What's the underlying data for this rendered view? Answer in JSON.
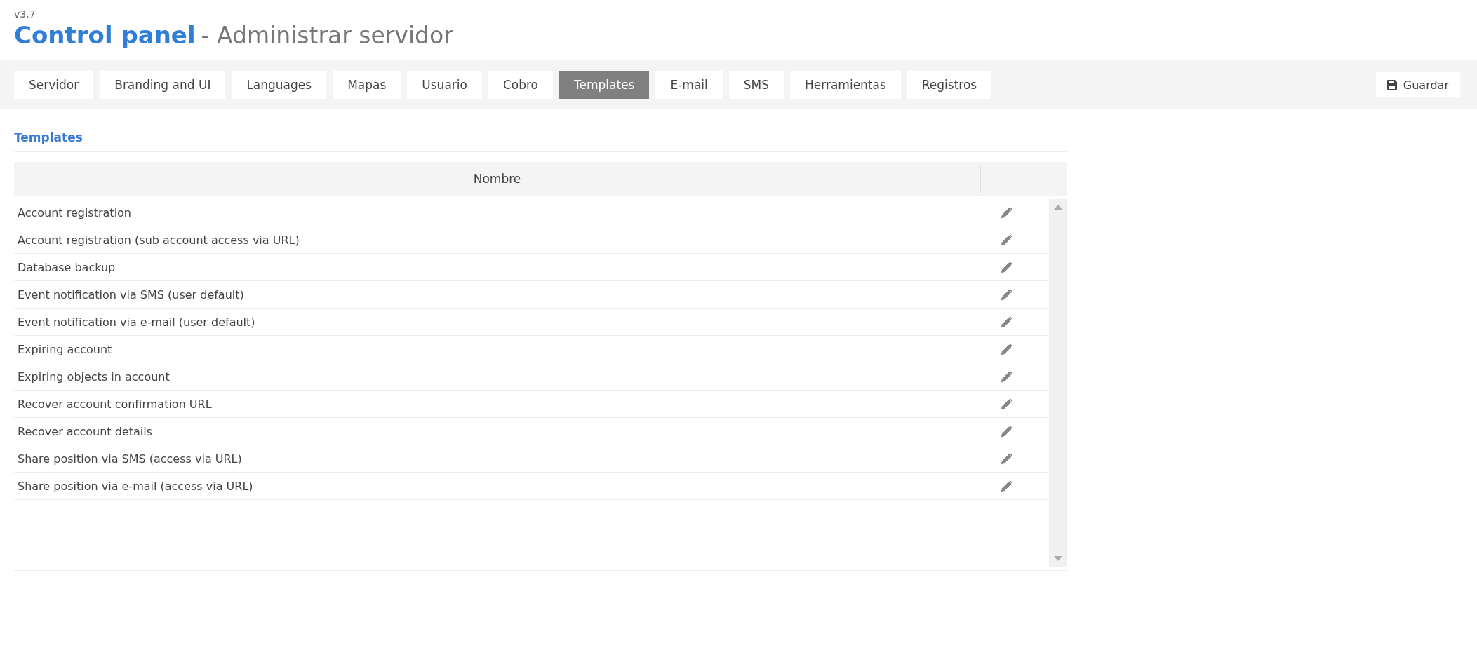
{
  "header": {
    "version": "v3.7",
    "title": "Control panel",
    "subtitle": "- Administrar servidor"
  },
  "tabs": [
    {
      "label": "Servidor",
      "selected": false
    },
    {
      "label": "Branding and UI",
      "selected": false
    },
    {
      "label": "Languages",
      "selected": false
    },
    {
      "label": "Mapas",
      "selected": false
    },
    {
      "label": "Usuario",
      "selected": false
    },
    {
      "label": "Cobro",
      "selected": false
    },
    {
      "label": "Templates",
      "selected": true
    },
    {
      "label": "E-mail",
      "selected": false
    },
    {
      "label": "SMS",
      "selected": false
    },
    {
      "label": "Herramientas",
      "selected": false
    },
    {
      "label": "Registros",
      "selected": false
    }
  ],
  "save_button": {
    "label": "Guardar"
  },
  "section_title": "Templates",
  "table": {
    "columns": [
      "Nombre"
    ],
    "rows": [
      "Account registration",
      "Account registration (sub account access via URL)",
      "Database backup",
      "Event notification via SMS (user default)",
      "Event notification via e-mail (user default)",
      "Expiring account",
      "Expiring objects in account",
      "Recover account confirmation URL",
      "Recover account details",
      "Share position via SMS (access via URL)",
      "Share position via e-mail (access via URL)"
    ]
  }
}
